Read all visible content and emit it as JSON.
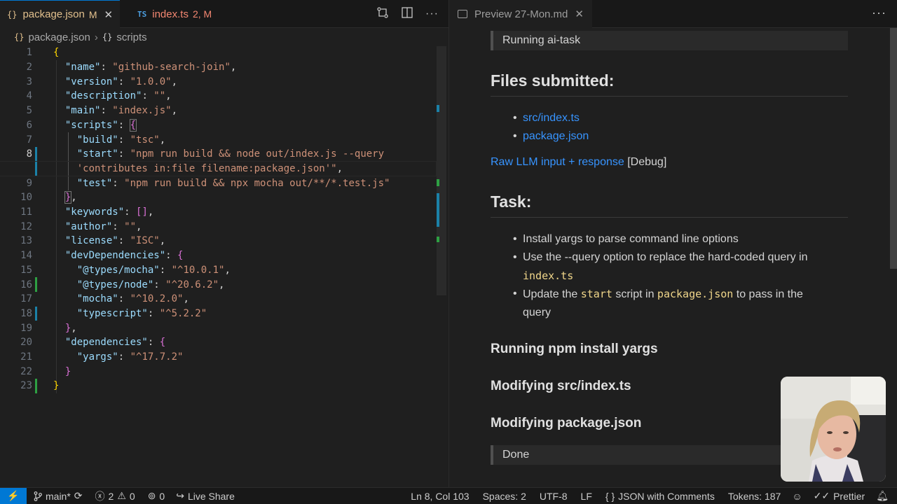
{
  "editor": {
    "tabs": [
      {
        "icon": "{}",
        "label": "package.json",
        "badge": "M",
        "close": "✕"
      },
      {
        "icon": "TS",
        "label": "index.ts",
        "badge": "2, M"
      }
    ],
    "breadcrumb": {
      "file_icon": "{}",
      "file": "package.json",
      "separator": "›",
      "symbol_icon": "{}",
      "symbol": "scripts"
    },
    "lines": [
      {
        "n": "1"
      },
      {
        "n": "2"
      },
      {
        "n": "3"
      },
      {
        "n": "4"
      },
      {
        "n": "5"
      },
      {
        "n": "6"
      },
      {
        "n": "7"
      },
      {
        "n": "8"
      },
      {
        "n": ""
      },
      {
        "n": "9"
      },
      {
        "n": "10"
      },
      {
        "n": "11"
      },
      {
        "n": "12"
      },
      {
        "n": "13"
      },
      {
        "n": "14"
      },
      {
        "n": "15"
      },
      {
        "n": "16"
      },
      {
        "n": "17"
      },
      {
        "n": "18"
      },
      {
        "n": "19"
      },
      {
        "n": "20"
      },
      {
        "n": "21"
      },
      {
        "n": "22"
      },
      {
        "n": "23"
      }
    ],
    "code": {
      "l1_open": "{",
      "name_key": "\"name\"",
      "name_val": "\"github-search-join\"",
      "version_key": "\"version\"",
      "version_val": "\"1.0.0\"",
      "description_key": "\"description\"",
      "description_val": "\"\"",
      "main_key": "\"main\"",
      "main_val": "\"index.js\"",
      "scripts_key": "\"scripts\"",
      "scripts_open": "{",
      "build_key": "\"build\"",
      "build_val": "\"tsc\"",
      "start_key": "\"start\"",
      "start_val_1": "\"npm run build && node out/index.js --query",
      "start_val_2": "'contributes in:file filename:package.json'\"",
      "test_key": "\"test\"",
      "test_val": "\"npm run build && npx mocha out/**/*.test.js\"",
      "scripts_close": "}",
      "keywords_key": "\"keywords\"",
      "keywords_val": "[]",
      "author_key": "\"author\"",
      "author_val": "\"\"",
      "license_key": "\"license\"",
      "license_val": "\"ISC\"",
      "devdeps_key": "\"devDependencies\"",
      "devdeps_open": "{",
      "mocha_types_key": "\"@types/mocha\"",
      "mocha_types_val": "\"^10.0.1\"",
      "node_types_key": "\"@types/node\"",
      "node_types_val": "\"^20.6.2\"",
      "mocha_key": "\"mocha\"",
      "mocha_val": "\"^10.2.0\"",
      "typescript_key": "\"typescript\"",
      "typescript_val": "\"^5.2.2\"",
      "devdeps_close": "}",
      "deps_key": "\"dependencies\"",
      "deps_open": "{",
      "yargs_key": "\"yargs\"",
      "yargs_val": "\"^17.7.2\"",
      "deps_close": "}",
      "l23_close": "}"
    }
  },
  "preview": {
    "tab_label": "Preview 27-Mon.md",
    "tab_close": "✕",
    "more": "···",
    "quote_running": "Running ai-task",
    "h_files": "Files submitted:",
    "files": [
      "src/index.ts",
      "package.json"
    ],
    "raw_link": "Raw LLM input + response",
    "debug": "[Debug]",
    "h_task": "Task:",
    "task_1": "Install yargs to parse command line options",
    "task_2_a": "Use the --query option to replace the hard-coded query in",
    "task_2_code": "index.ts",
    "task_3_a": "Update the",
    "task_3_code1": "start",
    "task_3_b": "script in",
    "task_3_code2": "package.json",
    "task_3_c": "to pass in the",
    "task_3_d": "query",
    "h_npm": "Running npm install yargs",
    "h_mod1": "Modifying src/index.ts",
    "h_mod2": "Modifying package.json",
    "quote_done": "Done"
  },
  "status": {
    "remote_icon": "⚡",
    "branch": "main*",
    "errors": "2",
    "warnings": "0",
    "ports": "0",
    "live_share": "Live Share",
    "position": "Ln 8, Col 103",
    "spaces": "Spaces: 2",
    "encoding": "UTF-8",
    "eol": "LF",
    "language": "JSON with Comments",
    "tokens": "Tokens: 187",
    "prettier": "Prettier"
  }
}
